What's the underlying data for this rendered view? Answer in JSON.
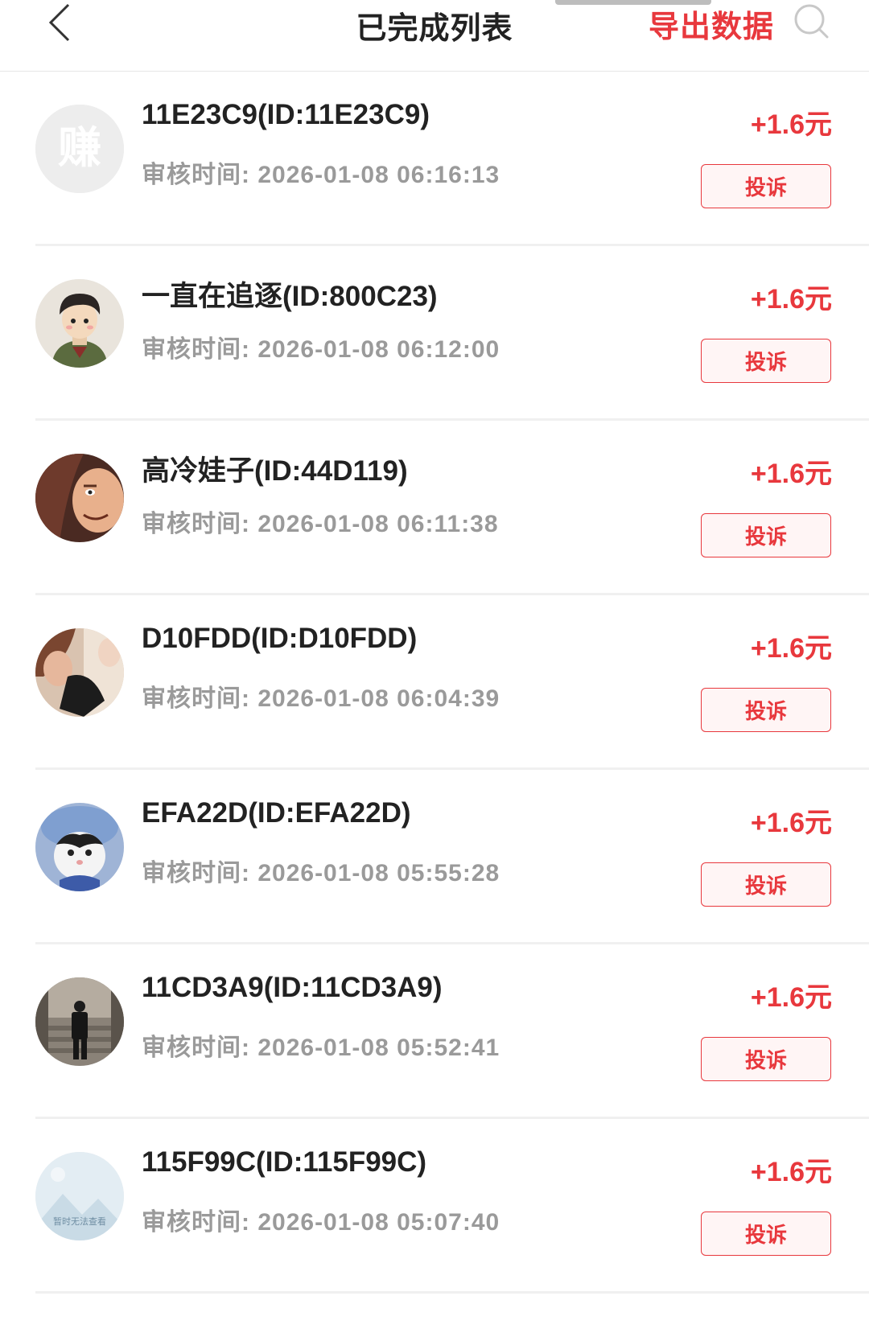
{
  "header": {
    "title": "已完成列表",
    "export_label": "导出数据"
  },
  "colors": {
    "accent": "#e8383d",
    "muted_text": "#9a9a9a"
  },
  "avatar_placeholder": {
    "text": "赚",
    "image_unavailable_text": "暂时无法查看"
  },
  "records": [
    {
      "name": "11E23C9(ID:11E23C9)",
      "time": "审核时间: 2026-01-08 06:16:13",
      "amount": "+1.6元",
      "action": "投诉"
    },
    {
      "name": "一直在追逐(ID:800C23)",
      "time": "审核时间: 2026-01-08 06:12:00",
      "amount": "+1.6元",
      "action": "投诉"
    },
    {
      "name": "高冷娃子(ID:44D119)",
      "time": "审核时间: 2026-01-08 06:11:38",
      "amount": "+1.6元",
      "action": "投诉"
    },
    {
      "name": "D10FDD(ID:D10FDD)",
      "time": "审核时间: 2026-01-08 06:04:39",
      "amount": "+1.6元",
      "action": "投诉"
    },
    {
      "name": "EFA22D(ID:EFA22D)",
      "time": "审核时间: 2026-01-08 05:55:28",
      "amount": "+1.6元",
      "action": "投诉"
    },
    {
      "name": "11CD3A9(ID:11CD3A9)",
      "time": "审核时间: 2026-01-08 05:52:41",
      "amount": "+1.6元",
      "action": "投诉"
    },
    {
      "name": "115F99C(ID:115F99C)",
      "time": "审核时间: 2026-01-08 05:07:40",
      "amount": "+1.6元",
      "action": "投诉"
    }
  ]
}
